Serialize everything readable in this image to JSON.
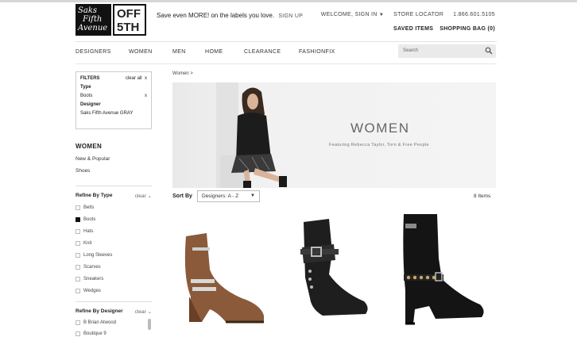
{
  "header": {
    "logo_saks_lines": [
      "Saks",
      "Fifth",
      "Avenue"
    ],
    "logo_off_lines": [
      "OFF",
      "5TH"
    ],
    "promo_text": "Save even MORE! on the labels you love.",
    "promo_link": "SIGN UP",
    "welcome": "WELCOME, SIGN IN",
    "store_locator": "STORE LOCATOR",
    "phone": "1.866.601.5105",
    "saved_items": "SAVED ITEMS",
    "shopping_bag": "SHOPPING BAG (0)"
  },
  "nav": {
    "items": [
      "DESIGNERS",
      "WOMEN",
      "MEN",
      "HOME",
      "CLEARANCE",
      "FASHIONFIX"
    ],
    "search_placeholder": "Search"
  },
  "filters": {
    "title": "FILTERS",
    "clear_all": "clear all",
    "type_label": "Type",
    "type_value": "Boots",
    "designer_label": "Designer",
    "designer_value": "Saks Fifth Avenue GRAY",
    "remove_glyph": "x"
  },
  "category": {
    "title": "WOMEN",
    "links": [
      "New & Popular",
      "Shoes"
    ]
  },
  "refine_type": {
    "title": "Refine By Type",
    "clear": "clear",
    "options": [
      {
        "label": "Belts",
        "checked": false
      },
      {
        "label": "Boots",
        "checked": true
      },
      {
        "label": "Hats",
        "checked": false
      },
      {
        "label": "Knit",
        "checked": false
      },
      {
        "label": "Long Sleeves",
        "checked": false
      },
      {
        "label": "Scarves",
        "checked": false
      },
      {
        "label": "Sneakers",
        "checked": false
      },
      {
        "label": "Wedges",
        "checked": false
      }
    ]
  },
  "refine_designer": {
    "title": "Refine By Designer",
    "clear": "clear",
    "options": [
      {
        "label": "B Brian Atwood",
        "checked": false
      },
      {
        "label": "Boutique 9",
        "checked": false
      }
    ]
  },
  "main": {
    "breadcrumb": "Women >",
    "hero_title": "WOMEN",
    "hero_subtitle": "Featuring Rebecca Taylor, Torn & Free People",
    "sort_label": "Sort By",
    "sort_value": "Designers: A - Z",
    "item_count": "8 Items"
  }
}
